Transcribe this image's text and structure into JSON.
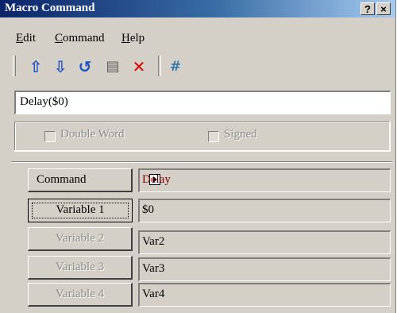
{
  "window": {
    "title": "Macro Command",
    "help_btn": "?",
    "close_btn": "×"
  },
  "menu": [
    {
      "accel": "E",
      "rest": "dit"
    },
    {
      "accel": "C",
      "rest": "ommand"
    },
    {
      "accel": "H",
      "rest": "elp"
    }
  ],
  "toolbar": {
    "move_up": "⇧",
    "move_down": "⇩",
    "undo": "↺",
    "edit": "▤",
    "delete": "✕",
    "hash": "#"
  },
  "expression": "Delay($0)",
  "options": {
    "double_word": "Double Word",
    "signed": "Signed"
  },
  "command_button": "Command",
  "command_value": "Delay",
  "variables": [
    {
      "button": "Variable 1",
      "value": "$0"
    },
    {
      "button": "Variable 2",
      "value": "Var2"
    },
    {
      "button": "Variable 3",
      "value": "Var3"
    },
    {
      "button": "Variable 4",
      "value": "Var4"
    }
  ],
  "colors": {
    "title_start": "#0a246a",
    "face": "#d4d0c8",
    "command_text": "#800000",
    "up": "#1a50c8",
    "undo": "#1a50c8",
    "delete": "#e00000",
    "hash": "#3a7aa8"
  }
}
